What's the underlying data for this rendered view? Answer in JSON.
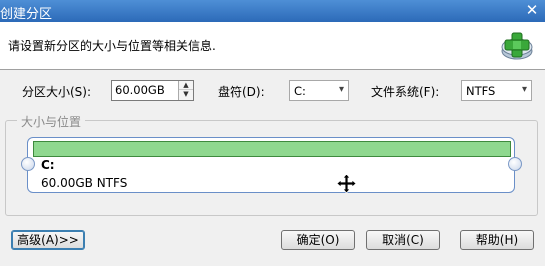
{
  "window": {
    "title": "创建分区",
    "close_glyph": "✕"
  },
  "banner": {
    "description": "请设置新分区的大小与位置等相关信息.",
    "icon": "add-partition-icon"
  },
  "form": {
    "size_label": "分区大小(S):",
    "size_value": "60.00GB",
    "drive_label": "盘符(D):",
    "drive_value": "C:",
    "fs_label": "文件系统(F):",
    "fs_value": "NTFS"
  },
  "group": {
    "label": "大小与位置",
    "partition_drive": "C:",
    "partition_info": "60.00GB NTFS",
    "bar_color": "#8fd88f"
  },
  "buttons": {
    "advanced": "高级(A)>>",
    "ok": "确定(O)",
    "cancel": "取消(C)",
    "help": "帮助(H)"
  }
}
